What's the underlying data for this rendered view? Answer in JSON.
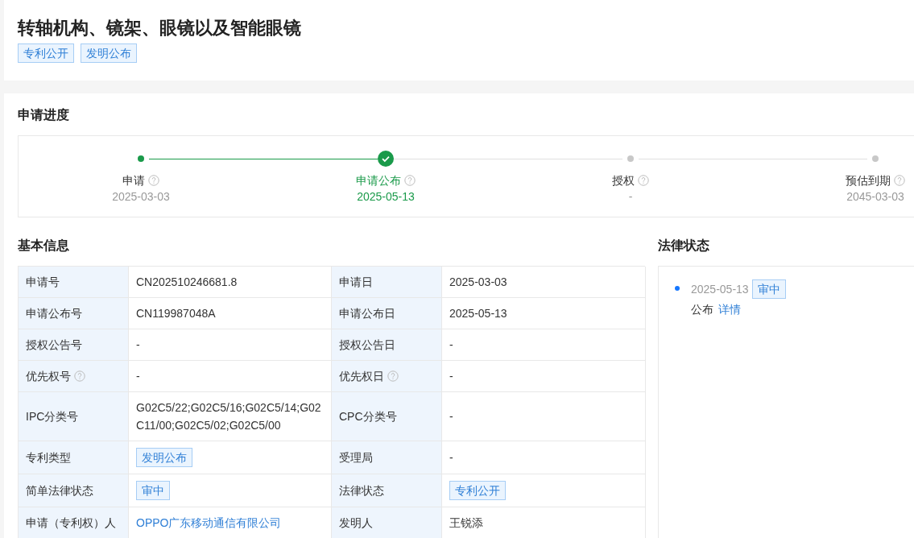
{
  "title": "转轴机构、镜架、眼镜以及智能眼镜",
  "title_tags": [
    "专利公开",
    "发明公布"
  ],
  "progress": {
    "heading": "申请进度",
    "steps": [
      {
        "label": "申请",
        "date": "2025-03-03",
        "kind": "done"
      },
      {
        "label": "申请公布",
        "date": "2025-05-13",
        "kind": "current"
      },
      {
        "label": "授权",
        "date": "-",
        "kind": "pending"
      },
      {
        "label": "预估到期",
        "date": "2045-03-03",
        "kind": "pending"
      }
    ]
  },
  "basic_info": {
    "heading": "基本信息",
    "rows": [
      [
        {
          "label": "申请号",
          "help": false,
          "kind": "text",
          "value": "CN202510246681.8"
        },
        {
          "label": "申请日",
          "help": false,
          "kind": "text",
          "value": "2025-03-03"
        }
      ],
      [
        {
          "label": "申请公布号",
          "help": false,
          "kind": "text",
          "value": "CN119987048A"
        },
        {
          "label": "申请公布日",
          "help": false,
          "kind": "text",
          "value": "2025-05-13"
        }
      ],
      [
        {
          "label": "授权公告号",
          "help": false,
          "kind": "text",
          "value": "-"
        },
        {
          "label": "授权公告日",
          "help": false,
          "kind": "text",
          "value": "-"
        }
      ],
      [
        {
          "label": "优先权号",
          "help": true,
          "kind": "text",
          "value": "-"
        },
        {
          "label": "优先权日",
          "help": true,
          "kind": "text",
          "value": "-"
        }
      ],
      [
        {
          "label": "IPC分类号",
          "help": false,
          "kind": "text",
          "value": "G02C5/22;G02C5/16;G02C5/14;G02C11/00;G02C5/02;G02C5/00"
        },
        {
          "label": "CPC分类号",
          "help": false,
          "kind": "text",
          "value": "-"
        }
      ],
      [
        {
          "label": "专利类型",
          "help": false,
          "kind": "tag",
          "value": "发明公布"
        },
        {
          "label": "受理局",
          "help": false,
          "kind": "text",
          "value": "-"
        }
      ],
      [
        {
          "label": "简单法律状态",
          "help": false,
          "kind": "tag",
          "value": "审中"
        },
        {
          "label": "法律状态",
          "help": false,
          "kind": "tag",
          "value": "专利公开"
        }
      ],
      [
        {
          "label": "申请（专利权）人",
          "help": false,
          "kind": "link",
          "value": "OPPO广东移动通信有限公司"
        },
        {
          "label": "发明人",
          "help": false,
          "kind": "text",
          "value": "王锐添"
        }
      ]
    ]
  },
  "legal_status": {
    "heading": "法律状态",
    "events": [
      {
        "date": "2025-05-13",
        "tag": "审中",
        "text": "公布",
        "link": "详情"
      }
    ]
  }
}
